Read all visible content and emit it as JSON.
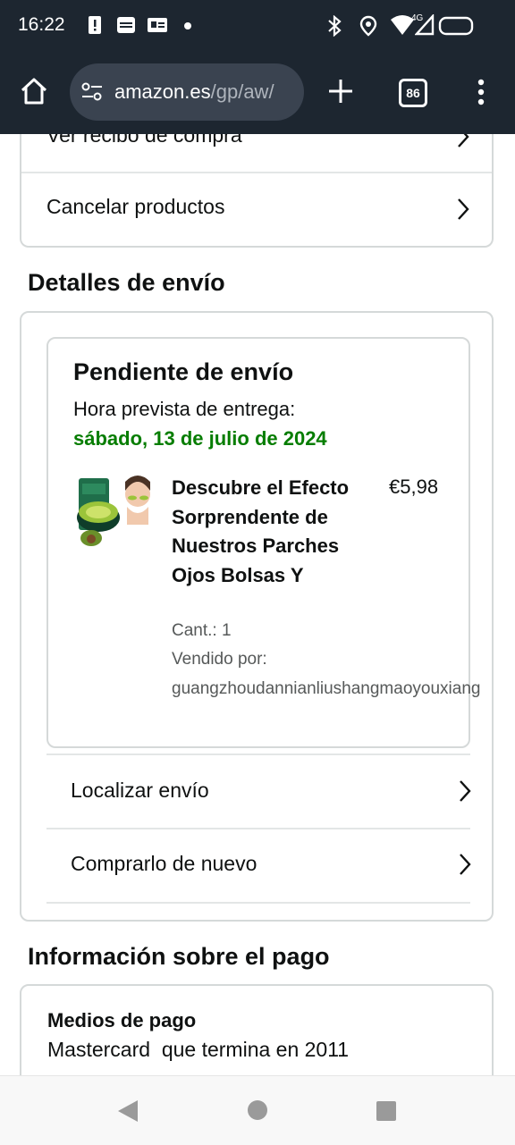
{
  "status_bar": {
    "time": "16:22",
    "icons": [
      "alert-icon",
      "burger-king-icon",
      "card-icon",
      "dot-icon",
      "bluetooth-icon",
      "location-icon",
      "wifi-icon",
      "signal-icon",
      "battery-icon"
    ],
    "network_label": "4G"
  },
  "browser": {
    "url_host": "amazon.es",
    "url_path": "/gp/aw/",
    "tab_count": "86"
  },
  "top_card": {
    "rows": [
      {
        "label": "Ver recibo de compra"
      },
      {
        "label": "Cancelar productos"
      }
    ]
  },
  "shipping": {
    "heading": "Detalles de envío",
    "status": "Pendiente de envío",
    "delivery_label": "Hora prevista de entrega:",
    "delivery_date": "sábado, 13 de julio de 2024",
    "product": {
      "title": "Descubre el Efecto Sorprendente de Nuestros Parches Ojos Bolsas Y",
      "price": "€5,98",
      "quantity": "Cant.: 1",
      "sold_by_label": "Vendido por:",
      "seller": "guangzhoudannianliushangmaoyouxiang"
    },
    "actions": [
      {
        "label": "Localizar envío"
      },
      {
        "label": "Comprarlo de nuevo"
      }
    ]
  },
  "payment": {
    "heading": "Información sobre el pago",
    "method_label": "Medios de pago",
    "method_value": "Mastercard  que termina en 2011"
  },
  "colors": {
    "status_bar_bg": "#1d2630",
    "delivery_green": "#067d00",
    "text": "#0f1111",
    "muted_text": "#565959",
    "border": "#d5d9d9"
  }
}
